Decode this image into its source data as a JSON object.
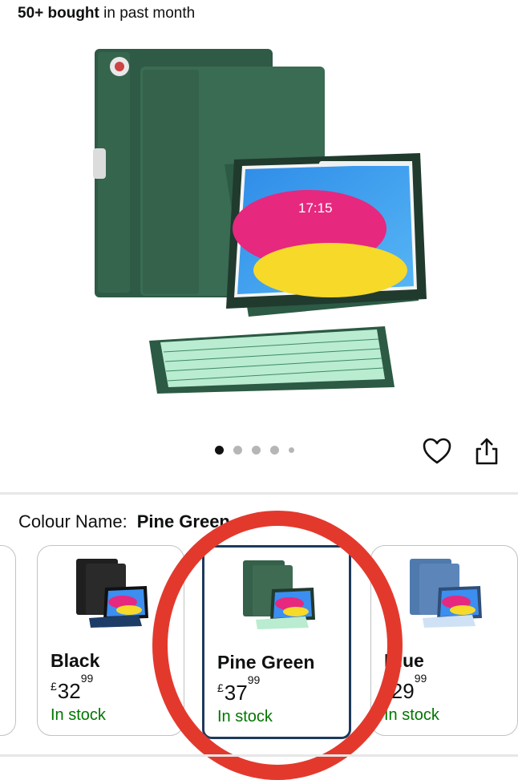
{
  "bought": {
    "bold": "50+ bought",
    "rest": " in past month"
  },
  "gallery": {
    "image_count": 5,
    "active_index": 0
  },
  "actions": {
    "wishlist_icon": "heart-icon",
    "share_icon": "share-icon"
  },
  "colour": {
    "label": "Colour Name:",
    "value": "Pine Green"
  },
  "variants": [
    {
      "name": "Black",
      "currency": "£",
      "price_whole": "32",
      "price_fraction": "99",
      "stock": "In stock",
      "case_color": "#1f1f1f"
    },
    {
      "name": "Pine Green",
      "currency": "£",
      "price_whole": "37",
      "price_fraction": "99",
      "stock": "In stock",
      "case_color": "#3f6b52",
      "selected": true
    },
    {
      "name": "Blue",
      "currency": "£",
      "price_whole": "29",
      "price_fraction": "99",
      "stock": "In stock",
      "case_color": "#5c86b9"
    }
  ],
  "colors": {
    "stock_green": "#007600",
    "annotation_red": "#e3392d",
    "selected_border": "#1c3a5c"
  }
}
